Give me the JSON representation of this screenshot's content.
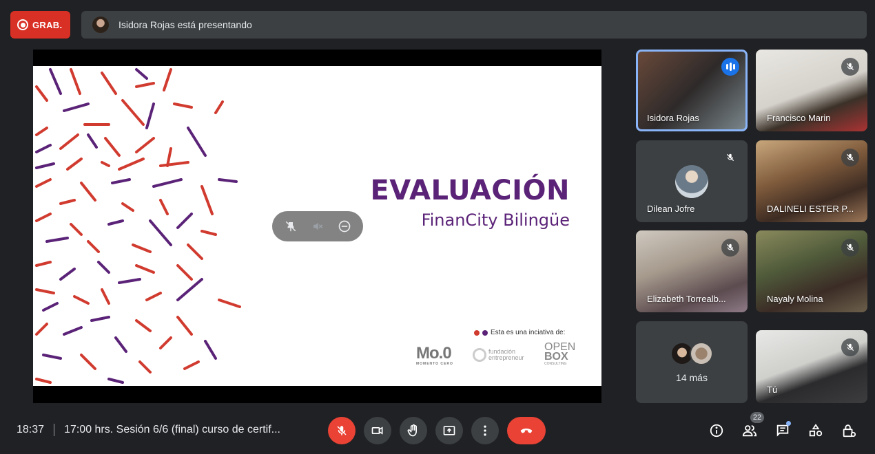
{
  "topbar": {
    "record_label": "GRAB.",
    "presenting_text": "Isidora Rojas está presentando"
  },
  "slide": {
    "title": "EVALUACIÓN",
    "subtitle": "FinanCity Bilingüe",
    "initiative": "Esta es una inciativa de:",
    "logos": {
      "moo": "Mo.0",
      "moo_tag": "MOMENTO CERO",
      "fundacion_1": "fundación",
      "fundacion_2": "entrepreneur",
      "openbox_1": "OPEN",
      "openbox_2": "BOX",
      "openbox_tag": "CONSULTING"
    },
    "colors": {
      "purple": "#5b2378",
      "red": "#d13b2f"
    }
  },
  "participants": [
    {
      "name": "Isidora Rojas",
      "state": "speaking"
    },
    {
      "name": "Francisco Marin",
      "state": "muted"
    },
    {
      "name": "Dilean Jofre",
      "state": "muted"
    },
    {
      "name": "DALINELI ESTER P...",
      "state": "muted"
    },
    {
      "name": "Elizabeth Torrealb...",
      "state": "muted"
    },
    {
      "name": "Nayaly Molina",
      "state": "muted"
    },
    {
      "name": "14 más",
      "state": "overflow"
    },
    {
      "name": "Tú",
      "state": "muted"
    }
  ],
  "bottombar": {
    "time": "18:37",
    "meeting_title": "17:00 hrs. Sesión 6/6 (final) curso de certif...",
    "people_count": "22"
  }
}
